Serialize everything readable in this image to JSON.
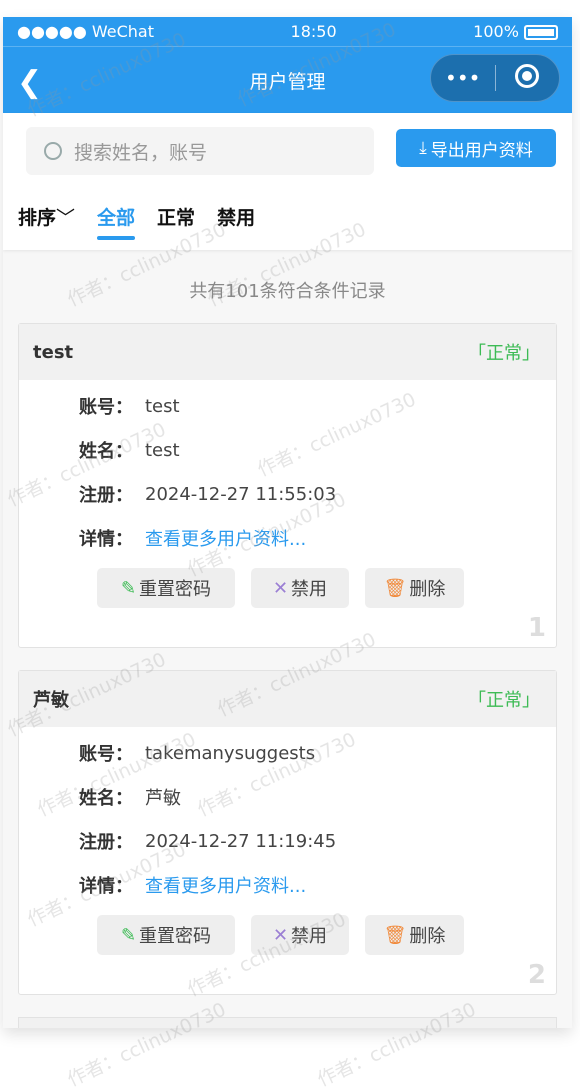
{
  "status_bar": {
    "signal": "●●●●● WeChat",
    "time": "18:50",
    "battery": "100%"
  },
  "nav": {
    "title": "用户管理",
    "more": "•••"
  },
  "search": {
    "placeholder": "搜索姓名，账号"
  },
  "export_label": "导出用户资料",
  "tabs": {
    "sort": "排序",
    "items": [
      "全部",
      "正常",
      "禁用"
    ],
    "active": "全部"
  },
  "summary": "共有101条符合条件记录",
  "labels": {
    "account": "账号：",
    "name": "姓名：",
    "register": "注册：",
    "detail": "详情："
  },
  "actions": {
    "reset": "重置密码",
    "ban": "禁用",
    "delete": "删除"
  },
  "users": [
    {
      "title": "test",
      "status": "「正常」",
      "account": "test",
      "name": "test",
      "register": "2024-12-27 11:55:03",
      "detail": "查看更多用户资料...",
      "index": "1"
    },
    {
      "title": "芦敏",
      "status": "「正常」",
      "account": "takemanysuggests",
      "name": "芦敏",
      "register": "2024-12-27 11:19:45",
      "detail": "查看更多用户资料...",
      "index": "2"
    }
  ],
  "watermark": "作者：cclinux0730",
  "colors": {
    "primary": "#2a9aee",
    "ok": "#3dbb55"
  }
}
